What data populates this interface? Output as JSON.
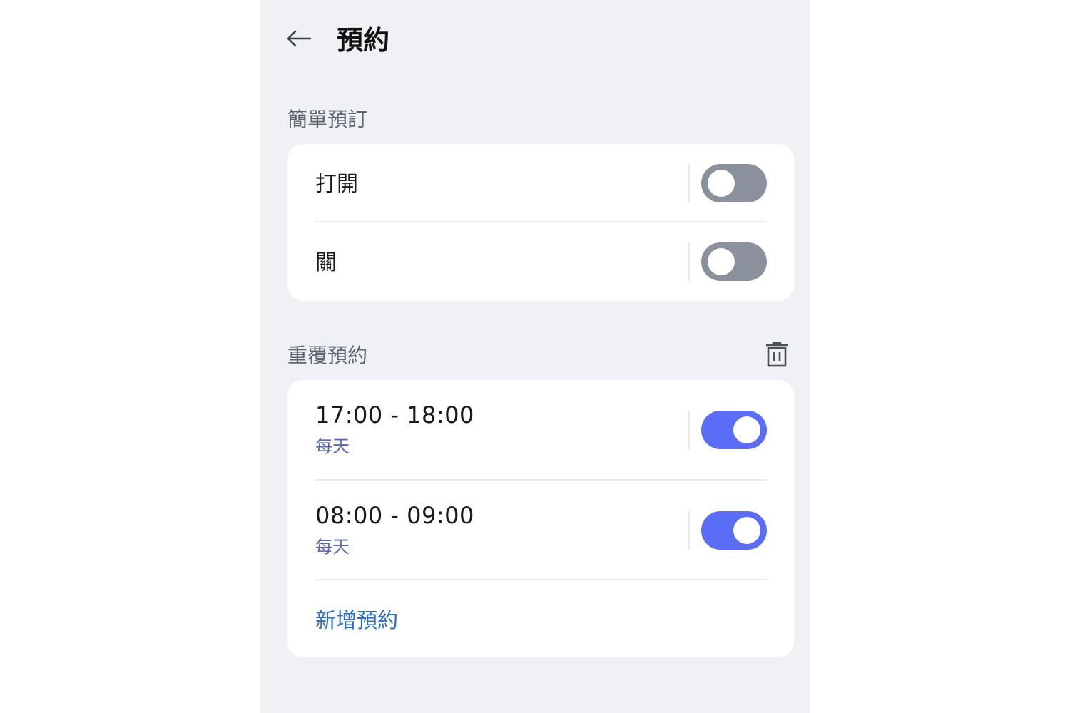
{
  "header": {
    "back_icon": "arrow-left-icon",
    "title": "預約"
  },
  "simple": {
    "section_label": "簡單預訂",
    "rows": [
      {
        "label": "打開",
        "enabled": false
      },
      {
        "label": "關",
        "enabled": false
      }
    ]
  },
  "repeat": {
    "section_label": "重覆預約",
    "delete_icon": "trash-icon",
    "schedules": [
      {
        "time": "17:00 - 18:00",
        "repeat": "每天",
        "enabled": true
      },
      {
        "time": "08:00 - 09:00",
        "repeat": "每天",
        "enabled": true
      }
    ],
    "add_label": "新增預約"
  },
  "colors": {
    "background": "#eff1f5",
    "toggle_on": "#5b6cf7",
    "toggle_off": "#8a909c",
    "link": "#2f6dc4"
  }
}
